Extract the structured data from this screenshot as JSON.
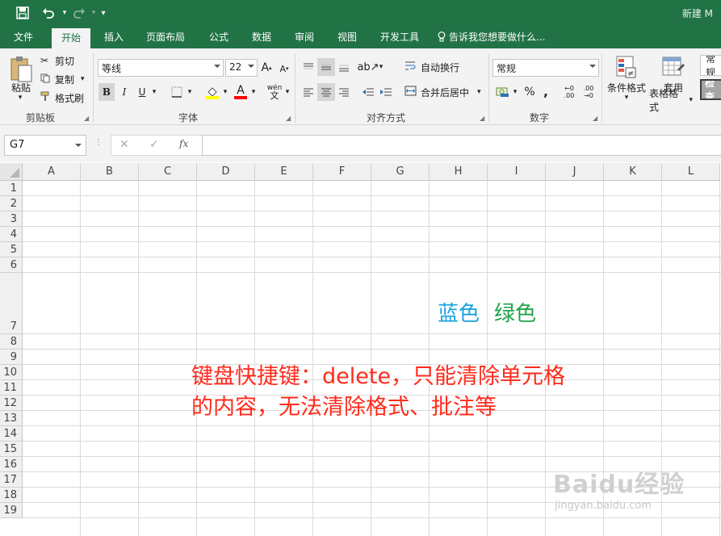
{
  "app": {
    "title_right": "新建 M"
  },
  "tabs": [
    "文件",
    "开始",
    "插入",
    "页面布局",
    "公式",
    "数据",
    "审阅",
    "视图",
    "开发工具"
  ],
  "tell_me": "告诉我您想要做什么...",
  "clipboard": {
    "paste": "粘贴",
    "cut": "剪切",
    "copy": "复制",
    "format_painter": "格式刷",
    "group_label": "剪贴板"
  },
  "font": {
    "name": "等线",
    "size": "22",
    "bold": "B",
    "italic": "I",
    "underline": "U",
    "grow": "A",
    "shrink": "A",
    "wen": "wén",
    "group_label": "字体"
  },
  "alignment": {
    "wrap": "自动换行",
    "merge": "合并后居中",
    "group_label": "对齐方式"
  },
  "number": {
    "format": "常规",
    "percent": "%",
    "comma": ",",
    "inc_dec": ".00",
    "dec_dec": ".00",
    "group_label": "数字"
  },
  "styles": {
    "conditional": "条件格式",
    "table_format_1": "套用",
    "table_format_2": "表格格式",
    "style_normal": "常规",
    "style_check": "检查"
  },
  "formula_bar": {
    "name_box": "G7",
    "fx": "fx",
    "content": ""
  },
  "columns": [
    "A",
    "B",
    "C",
    "D",
    "E",
    "F",
    "G",
    "H",
    "I",
    "J",
    "K",
    "L"
  ],
  "rows": [
    "1",
    "2",
    "3",
    "4",
    "5",
    "6",
    "7",
    "8",
    "9",
    "10",
    "11",
    "12",
    "13",
    "14",
    "15",
    "16",
    "17",
    "18",
    "19"
  ],
  "cells": {
    "blue_text": "蓝色",
    "green_text": "绿色"
  },
  "colors": {
    "excel_green": "#217346",
    "blue_text": "#17a2dd",
    "green_text": "#1fa24a",
    "annotation": "#ff2b1c"
  },
  "annotation": {
    "line1": "键盘快捷键：delete，只能清除单元格",
    "line2": "的内容，无法清除格式、批注等"
  },
  "watermark": {
    "brand": "Baidu经验",
    "url": "jingyan.baidu.com"
  }
}
